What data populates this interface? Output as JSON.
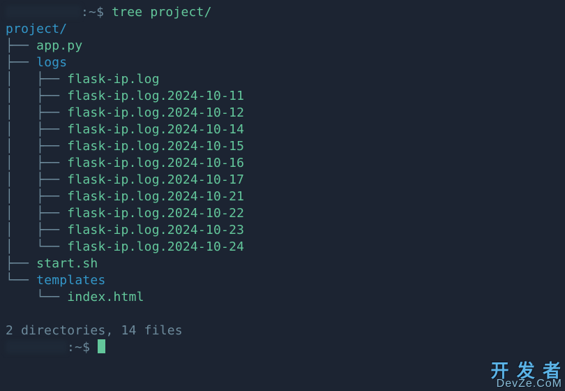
{
  "prompt": {
    "user_host_obscured": true,
    "separator": ":~$ ",
    "command": "tree project/"
  },
  "tree": {
    "root": "project/",
    "children": [
      {
        "prefix": "├── ",
        "name": "app.py",
        "type": "file"
      },
      {
        "prefix": "├── ",
        "name": "logs",
        "type": "dir",
        "children": [
          {
            "prefix": "│   ├── ",
            "name": "flask-ip.log",
            "type": "file"
          },
          {
            "prefix": "│   ├── ",
            "name": "flask-ip.log.2024-10-11",
            "type": "file"
          },
          {
            "prefix": "│   ├── ",
            "name": "flask-ip.log.2024-10-12",
            "type": "file"
          },
          {
            "prefix": "│   ├── ",
            "name": "flask-ip.log.2024-10-14",
            "type": "file"
          },
          {
            "prefix": "│   ├── ",
            "name": "flask-ip.log.2024-10-15",
            "type": "file"
          },
          {
            "prefix": "│   ├── ",
            "name": "flask-ip.log.2024-10-16",
            "type": "file"
          },
          {
            "prefix": "│   ├── ",
            "name": "flask-ip.log.2024-10-17",
            "type": "file"
          },
          {
            "prefix": "│   ├── ",
            "name": "flask-ip.log.2024-10-21",
            "type": "file"
          },
          {
            "prefix": "│   ├── ",
            "name": "flask-ip.log.2024-10-22",
            "type": "file"
          },
          {
            "prefix": "│   ├── ",
            "name": "flask-ip.log.2024-10-23",
            "type": "file"
          },
          {
            "prefix": "│   └── ",
            "name": "flask-ip.log.2024-10-24",
            "type": "file"
          }
        ]
      },
      {
        "prefix": "├── ",
        "name": "start.sh",
        "type": "file"
      },
      {
        "prefix": "└── ",
        "name": "templates",
        "type": "dir",
        "children": [
          {
            "prefix": "    └── ",
            "name": "index.html",
            "type": "file"
          }
        ]
      }
    ]
  },
  "summary": "2 directories, 14 files",
  "prompt2": {
    "user_host_obscured": true,
    "separator": ":~$ "
  },
  "watermark": {
    "line1": "开 发 者",
    "line2": "DevZe.CoM"
  }
}
